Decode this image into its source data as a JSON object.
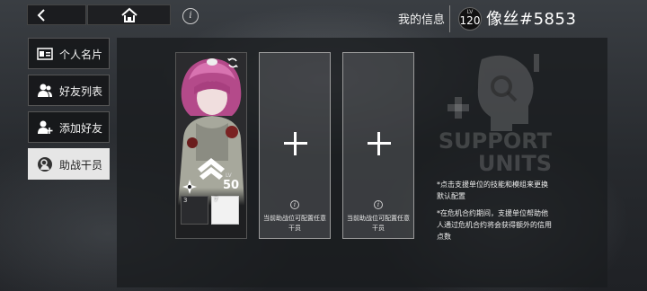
{
  "header": {
    "my_info_label": "我的信息",
    "level_label": "LV",
    "level_value": "120",
    "username": "像丝#5853"
  },
  "icons": {
    "back": "back-arrow-icon",
    "home": "home-icon",
    "info": "info-icon",
    "swap": "swap-icon"
  },
  "sidebar": {
    "items": [
      {
        "label": "个人名片",
        "icon": "id-card-icon",
        "active": false
      },
      {
        "label": "好友列表",
        "icon": "friends-icon",
        "active": false
      },
      {
        "label": "添加好友",
        "icon": "add-friend-icon",
        "active": false
      },
      {
        "label": "助战干员",
        "icon": "support-operator-icon",
        "active": true
      }
    ]
  },
  "operator_card": {
    "level_label": "LV",
    "level_value": "50",
    "skill_1_level": "3",
    "skill_2_level": "7"
  },
  "empty_slots": [
    {
      "text": "当前助战位可配置任意干员"
    },
    {
      "text": "当前助战位可配置任意干员"
    }
  ],
  "support_units": {
    "line1": "SUPPORT",
    "line2": "UNITS"
  },
  "notes": [
    "*点击支援单位的技能和模组来更换默认配置",
    "*在危机合约期间，支援单位帮助他人通过危机合约将会获得额外的信用点数"
  ],
  "colors": {
    "active_tab_bg": "#e6e6e6",
    "panel_bg": "#1a1c1f",
    "accent_pink": "#c94f8f"
  }
}
